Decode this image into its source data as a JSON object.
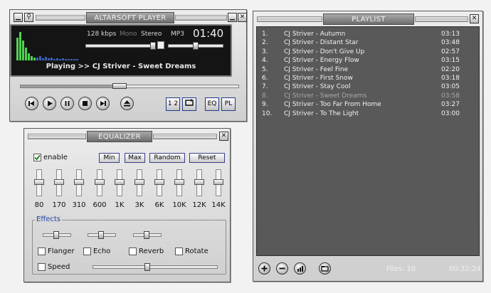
{
  "player": {
    "title": "ALTARSOFT PLAYER",
    "bitrate": "128 kbps",
    "mono": "Mono",
    "stereo": "Stereo",
    "format": "MP3",
    "time": "01:40",
    "now_playing": "Playing >> CJ Striver - Sweet Dreams",
    "seek_fraction": 0.45,
    "btn_repeat": "1 2",
    "btn_eq": "EQ",
    "btn_pl": "PL"
  },
  "equalizer": {
    "title": "EQUALIZER",
    "enable_label": "enable",
    "enabled": true,
    "buttons": [
      "Min",
      "Max",
      "Random",
      "Reset"
    ],
    "bands": [
      "80",
      "170",
      "310",
      "600",
      "1K",
      "3K",
      "6K",
      "10K",
      "12K",
      "14K"
    ],
    "effects_label": "Effects",
    "effects": [
      "Flanger",
      "Echo",
      "Reverb",
      "Rotate"
    ],
    "speed_label": "Speed"
  },
  "playlist": {
    "title": "PLAYLIST",
    "tracks": [
      {
        "num": "1.",
        "title": "CJ Striver - Autumn",
        "duration": "03:13"
      },
      {
        "num": "2.",
        "title": "CJ Striver - Distant Star",
        "duration": "03:48"
      },
      {
        "num": "3.",
        "title": "CJ Striver - Don't Give Up",
        "duration": "02:57"
      },
      {
        "num": "4.",
        "title": "CJ Striver - Energy Flow",
        "duration": "03:15"
      },
      {
        "num": "5.",
        "title": "CJ Striver - Feel Fine",
        "duration": "02:20"
      },
      {
        "num": "6.",
        "title": "CJ Striver - First Snow",
        "duration": "03:18"
      },
      {
        "num": "7.",
        "title": "CJ Striver - Stay Cool",
        "duration": "03:05"
      },
      {
        "num": "8.",
        "title": "CJ Striver - Sweet Dreams",
        "duration": "03:58"
      },
      {
        "num": "9.",
        "title": "CJ Striver - Too Far From Home",
        "duration": "03:27"
      },
      {
        "num": "10.",
        "title": "CJ Striver - To The Light",
        "duration": "03:00"
      }
    ],
    "files": "Files: 10",
    "total_time": "00:32:24"
  },
  "colors": {
    "display_bg": "#141414",
    "playlist_bg": "#595959",
    "spectrum": "#4fd24f",
    "accent_blue": "#1e3a8a"
  },
  "icons": {
    "prev": "prev-icon",
    "play": "play-icon",
    "pause": "pause-icon",
    "stop": "stop-icon",
    "next": "next-icon",
    "eject": "eject-icon",
    "add": "plus-icon",
    "remove": "minus-icon",
    "sort": "bars-icon",
    "open": "folder-icon"
  }
}
